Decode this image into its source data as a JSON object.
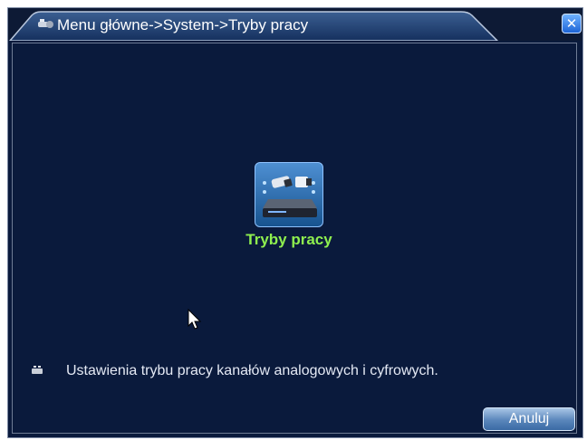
{
  "window": {
    "breadcrumb": "Menu główne->System->Tryby pracy",
    "close_icon": "close-icon"
  },
  "main": {
    "module": {
      "label": "Tryby pracy",
      "icon": "camera-dvr-icon"
    },
    "description": "Ustawienia trybu pracy kanałów analogowych i cyfrowych."
  },
  "footer": {
    "cancel_label": "Anuluj"
  },
  "colors": {
    "background": "#0a1a3c",
    "label_green": "#8ff04f",
    "text": "#e4e9f4"
  }
}
